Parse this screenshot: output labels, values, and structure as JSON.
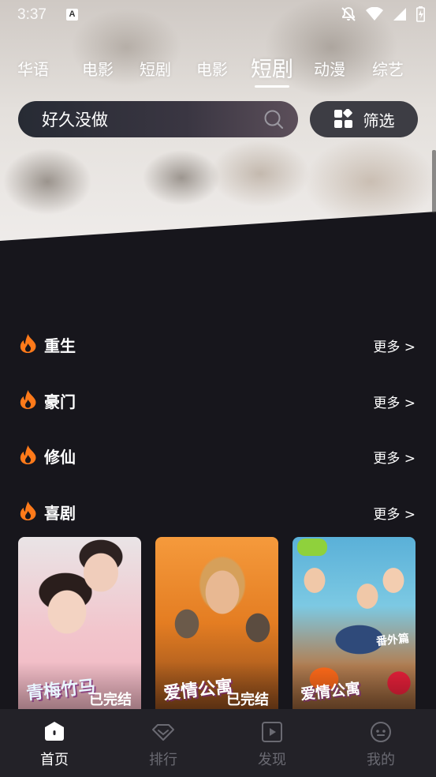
{
  "status_bar": {
    "time": "3:37",
    "indicator": "A"
  },
  "tabs": [
    {
      "label": "华语"
    },
    {
      "label": "电影"
    },
    {
      "label": "短剧"
    },
    {
      "label": "电影"
    },
    {
      "label": "短剧",
      "active": true
    },
    {
      "label": "动漫"
    },
    {
      "label": "综艺"
    }
  ],
  "search": {
    "value": "好久没做",
    "icon": "search-icon"
  },
  "filter": {
    "label": "筛选",
    "icon": "grid-icon"
  },
  "sections": [
    {
      "title": "重生",
      "more": "更多 >"
    },
    {
      "title": "豪门",
      "more": "更多 >"
    },
    {
      "title": "修仙",
      "more": "更多 >"
    },
    {
      "title": "喜剧",
      "more": "更多 >"
    }
  ],
  "cards": [
    {
      "poster_title": "青梅竹马",
      "tag": "已完结"
    },
    {
      "poster_title": "爱情公寓",
      "tag": "已完结"
    },
    {
      "poster_title": "爱情公寓",
      "tag": "番外篇"
    }
  ],
  "bottom_nav": [
    {
      "label": "首页",
      "icon": "home-icon",
      "active": true
    },
    {
      "label": "排行",
      "icon": "diamond-icon"
    },
    {
      "label": "发现",
      "icon": "play-square-icon"
    },
    {
      "label": "我的",
      "icon": "face-icon"
    }
  ],
  "colors": {
    "accent_flame": "#ff7a1a",
    "background": "#17161c",
    "nav_background": "#232228"
  }
}
